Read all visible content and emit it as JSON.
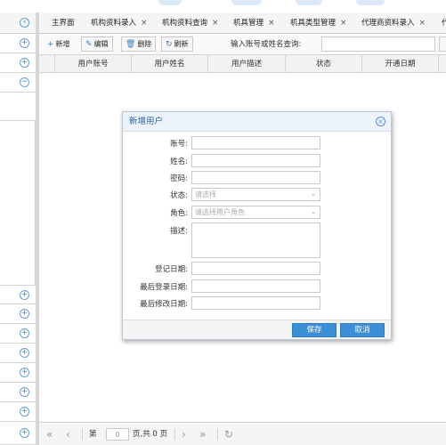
{
  "tabs": [
    {
      "label": "主界面",
      "closable": false
    },
    {
      "label": "机构资料录入",
      "closable": true
    },
    {
      "label": "机构资料查询",
      "closable": true
    },
    {
      "label": "机具管理",
      "closable": true
    },
    {
      "label": "机具类型管理",
      "closable": true
    },
    {
      "label": "代理商资料录入",
      "closable": true
    },
    {
      "label": "代",
      "closable": false
    }
  ],
  "tab_close_glyph": "×",
  "toolbar": {
    "add": "新增",
    "edit": "编辑",
    "delete": "删除",
    "refresh": "刷新",
    "search_label": "输入账号或姓名查询:",
    "search_value": ""
  },
  "grid": {
    "columns": [
      "用户账号",
      "用户姓名",
      "用户描述",
      "状态",
      "开通日期"
    ]
  },
  "pager": {
    "page_label": "第",
    "page_value": "0",
    "total_label": "页,共 0 页"
  },
  "dialog": {
    "title": "新增用户",
    "fields": [
      {
        "label": "账号:",
        "value": ""
      },
      {
        "label": "姓名:",
        "value": ""
      },
      {
        "label": "密码:",
        "value": ""
      },
      {
        "label": "状态:",
        "placeholder": "请选择"
      },
      {
        "label": "角色:",
        "placeholder": "请选择用户角色"
      },
      {
        "label": "描述:",
        "value": ""
      },
      {
        "label": "登记日期:",
        "value": ""
      },
      {
        "label": "最后登录日期:",
        "value": ""
      },
      {
        "label": "最后修改日期:",
        "value": ""
      }
    ],
    "save": "保存",
    "cancel": "取消"
  },
  "colors": {
    "accent": "#3b8fd6",
    "dialog_title": "#2b5f9c",
    "icon_blue": "#4a86c8"
  },
  "icons": {
    "sidebar_collapse": "chevron-left-circle-icon",
    "sidebar_expand": "plus-circle-icon",
    "sidebar_collapse_section": "minus-circle-icon",
    "dialog_close": "close-circle-icon"
  }
}
